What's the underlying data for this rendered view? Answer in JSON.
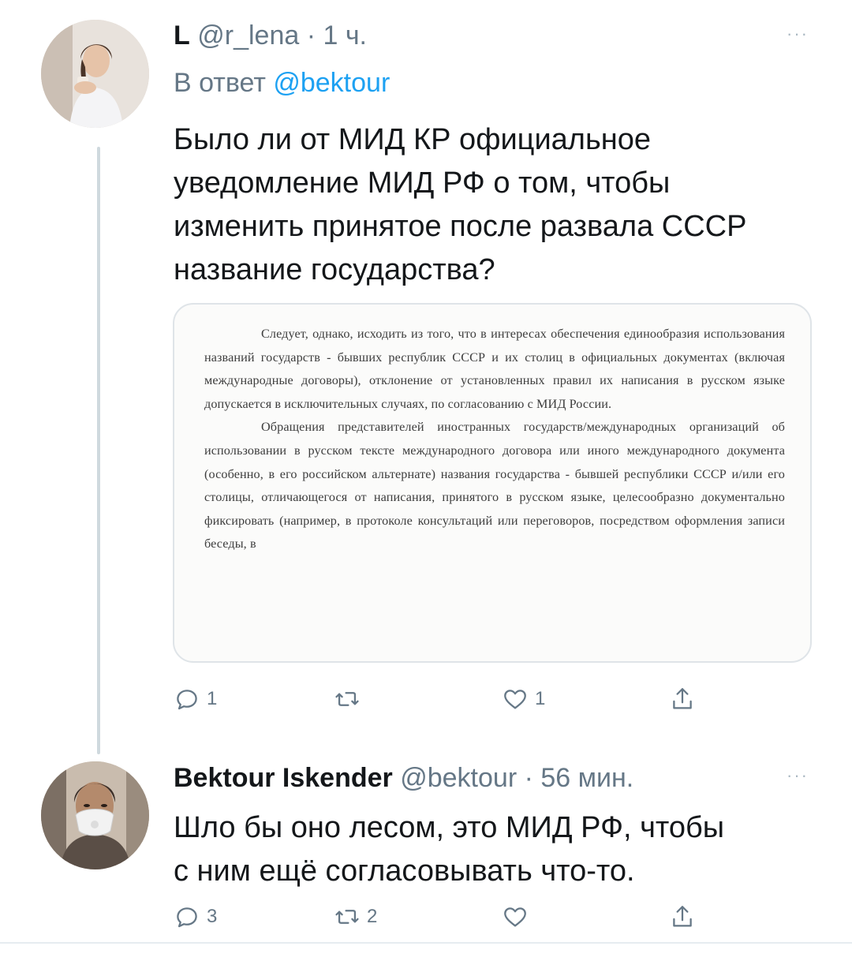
{
  "tweets": [
    {
      "author": {
        "display_name": "L",
        "handle": "@r_lena",
        "time": "· 1 ч."
      },
      "reply_to": {
        "prefix": "В ответ ",
        "handle": "@bektour"
      },
      "text_lines": [
        "Было ли от МИД КР официальное",
        "уведомление МИД РФ о том, чтобы",
        "изменить принятое после развала СССР",
        "название государства?"
      ],
      "image": {
        "paragraphs": [
          "Следует, однако, исходить из того, что в интересах обеспечения единообразия использования названий государств - бывших республик СССР и их столиц в официальных документах (включая международные договоры), отклонение от установленных правил их написания в русском языке допускается в исключительных случаях, по согласованию с МИД России.",
          "Обращения представителей иностранных государств/международных организаций об использовании в русском тексте международного договора или иного международного документа (особенно, в его российском альтернате) названия государства - бывшей республики СССР и/или его столицы, отличающегося от написания, принятого в русском языке, целесообразно документально фиксировать (например, в протоколе консультаций или переговоров, посредством оформления записи беседы, в"
        ]
      },
      "actions": {
        "reply_count": "1",
        "retweet_count": "",
        "like_count": "1",
        "share_label": ""
      }
    },
    {
      "author": {
        "display_name": "Bektour Iskender",
        "handle": "@bektour",
        "time": "· 56 мин."
      },
      "text_lines": [
        "Шло бы оно лесом, это МИД РФ, чтобы",
        "с ним ещё согласовывать что-то."
      ],
      "actions": {
        "reply_count": "3",
        "retweet_count": "2",
        "like_count": "",
        "share_label": ""
      }
    }
  ],
  "more_menu_glyph": "···",
  "icons": [
    "reply-icon",
    "retweet-icon",
    "like-icon",
    "share-icon",
    "more-icon"
  ],
  "colors": {
    "text": "#14171a",
    "secondary": "#657786",
    "link": "#1da1f2",
    "thread_line": "#cfd9de"
  }
}
